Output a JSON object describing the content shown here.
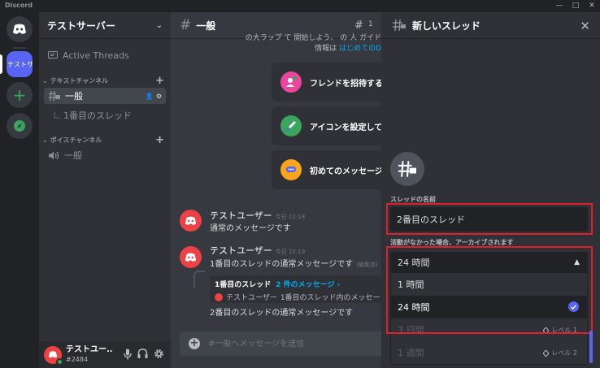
{
  "window": {
    "title": "Discord"
  },
  "servers": {
    "active_label": "テストサーバ"
  },
  "sidebar": {
    "server_name": "テストサーバー",
    "active_threads": "Active Threads",
    "text_category": "テキストチャンネル",
    "text_channel": "一般",
    "thread_item": "1番目のスレッド",
    "voice_category": "ボイスチャンネル",
    "voice_channel": "一般"
  },
  "user": {
    "name": "テストユー...",
    "tag": "#2484"
  },
  "chat": {
    "channel_title": "一般",
    "thread_count": "1",
    "welcome_line1": "の大ラップ て 開始しよう、 の 人 ガイド",
    "welcome_prefix": "情報は",
    "welcome_link": "はじめてのD",
    "cards": {
      "invite": "フレンドを招待する",
      "icon": "アイコンを設定して",
      "first_msg": "初めてのメッセージ"
    },
    "messages": [
      {
        "author": "テストユーザー",
        "time": "今日 22:18",
        "text": "通常のメッセージです"
      },
      {
        "author": "テストユーザー",
        "time": "今日 22:19",
        "text": "1番目のスレッドの通常メッセージです",
        "edited": "(編集済)"
      }
    ],
    "thread_embed": {
      "name": "1番目のスレッド",
      "count": "2 件のメッセージ ›",
      "preview_author": "テストユーザー",
      "preview_text": "1番目のスレッド内のメッセー"
    },
    "followup_text": "2番目のスレッドの通常メッセージです",
    "composer_placeholder": "#一般へメッセージを送信"
  },
  "thread_panel": {
    "title": "新しいスレッド",
    "name_label": "スレッドの名前",
    "name_value": "2番目のスレッド",
    "archive_label": "活動がなかった場合、アーカイブされます",
    "archive_selected": "24 時間",
    "options": [
      {
        "label": "1 時間"
      },
      {
        "label": "24 時間"
      },
      {
        "label": "3 日間",
        "level": "レベル 1"
      },
      {
        "label": "1 週間",
        "level": "レベル 2"
      }
    ]
  },
  "colors": {
    "brand": "#5865f2",
    "highlight": "#e01e2e",
    "online": "#3ba55d",
    "avatar": "#ed4245"
  }
}
